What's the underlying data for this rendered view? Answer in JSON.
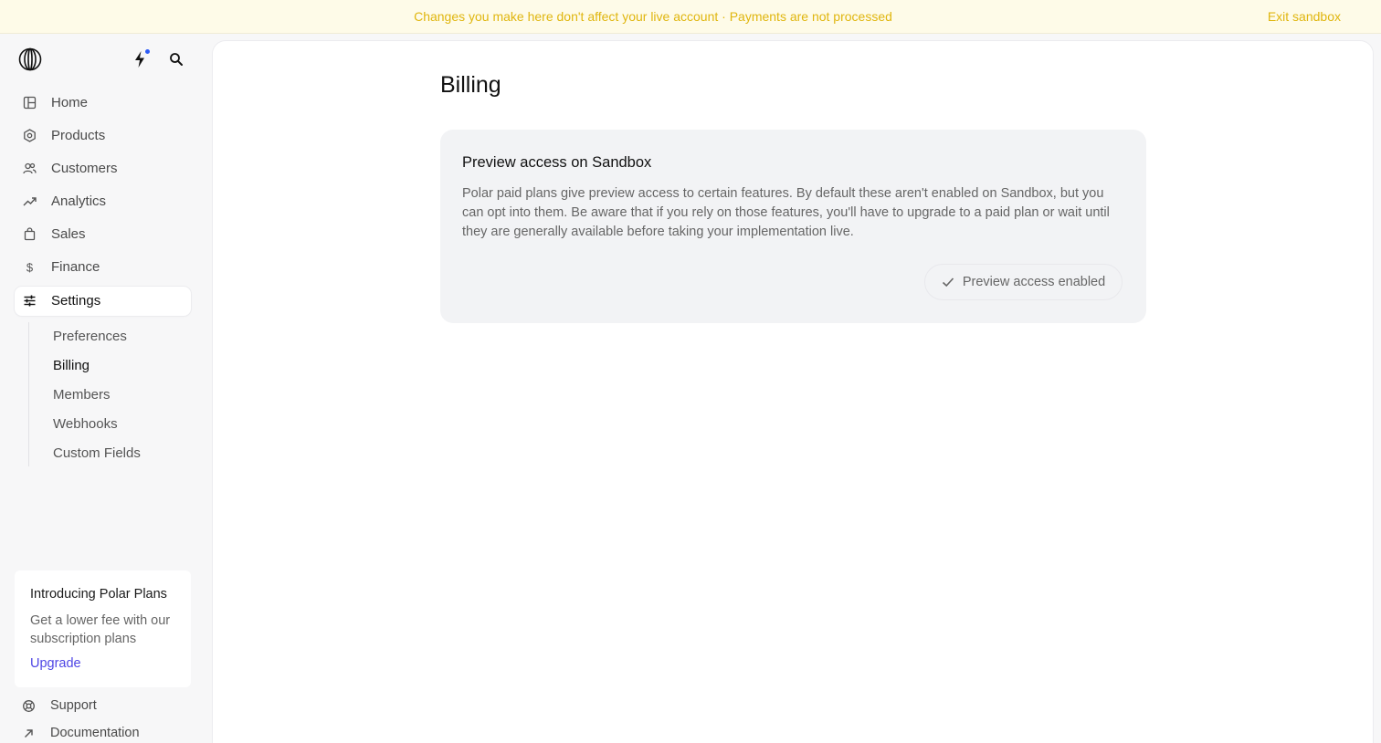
{
  "banner": {
    "message": "Changes you make here don't affect your live account · Payments are not processed",
    "exit_label": "Exit sandbox"
  },
  "sidebar": {
    "items": [
      {
        "label": "Home",
        "icon": "dashboard-icon"
      },
      {
        "label": "Products",
        "icon": "hexagon-icon"
      },
      {
        "label": "Customers",
        "icon": "people-icon"
      },
      {
        "label": "Analytics",
        "icon": "trending-up-icon"
      },
      {
        "label": "Sales",
        "icon": "shopping-bag-icon"
      },
      {
        "label": "Finance",
        "icon": "dollar-icon"
      },
      {
        "label": "Settings",
        "icon": "sliders-icon",
        "active": true
      }
    ],
    "settings_subitems": [
      {
        "label": "Preferences"
      },
      {
        "label": "Billing",
        "active": true
      },
      {
        "label": "Members"
      },
      {
        "label": "Webhooks"
      },
      {
        "label": "Custom Fields"
      }
    ],
    "promo": {
      "title": "Introducing Polar Plans",
      "text": "Get a lower fee with our subscription plans",
      "link": "Upgrade"
    },
    "footer": [
      {
        "label": "Support",
        "icon": "lifebuoy-icon"
      },
      {
        "label": "Documentation",
        "icon": "arrow-up-right-icon"
      }
    ]
  },
  "main": {
    "title": "Billing",
    "card": {
      "title": "Preview access on Sandbox",
      "text": "Polar paid plans give preview access to certain features. By default these aren't enabled on Sandbox, but you can opt into them. Be aware that if you rely on those features, you'll have to upgrade to a paid plan or wait until they are generally available before taking your implementation live.",
      "button_label": "Preview access enabled"
    }
  },
  "colors": {
    "banner_text": "#e0b60f",
    "banner_bg": "#fefbe8",
    "link": "#4f46e5",
    "notification_dot": "#2d5cf6"
  }
}
